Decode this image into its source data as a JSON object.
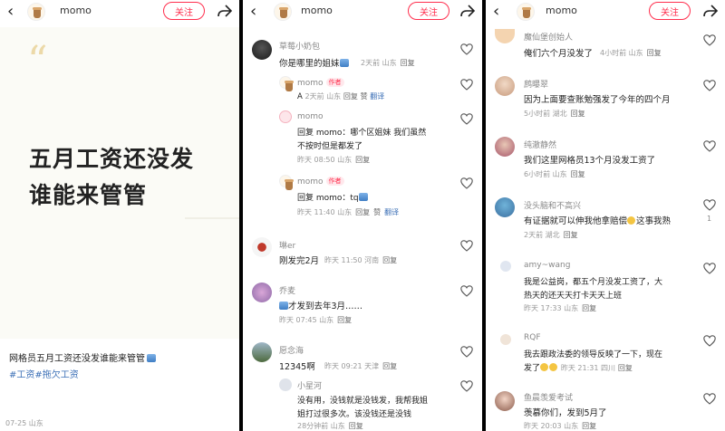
{
  "colors": {
    "accent": "#ff2e4d",
    "link": "#3b6fb6",
    "meta": "#999999"
  },
  "post_panel": {
    "username": "momo",
    "follow_label": "关注",
    "headline_line1_a": "五月",
    "headline_line1_hl": "工资",
    "headline_line1_b": "还没发",
    "headline_line2": "谁能来管管",
    "caption": "网格员五月工资还没发谁能来管管",
    "tags": "#工资#拖欠工资",
    "date": "07-25 山东"
  },
  "comments_panel_1": {
    "username": "momo",
    "follow_label": "关注",
    "comments": [
      {
        "name": "草莓小奶包",
        "text": "你是哪里的姐妹",
        "time": "2天前 山东",
        "reply": "回复"
      },
      {
        "name": "momo",
        "author_tag": "作者",
        "text": "A",
        "time": "2天前 山东",
        "reply": "回复",
        "like": "赞",
        "translate": "翻译"
      },
      {
        "name": "momo",
        "text1": "回复  momo：哪个区姐妹 我们虽然",
        "text2": "不按时但是都发了",
        "time": "昨天 08:50 山东",
        "reply": "回复"
      },
      {
        "name": "momo",
        "author_tag": "作者",
        "text": "回复  momo：tq",
        "time": "昨天 11:40 山东",
        "reply": "回复",
        "like": "赞",
        "translate": "翻译"
      },
      {
        "name": "琳er",
        "text": "刚发完2月",
        "time": "昨天 11:50 河南",
        "reply": "回复"
      },
      {
        "name": "乔麦",
        "text": "才发到去年3月……",
        "time": "昨天 07:45 山东",
        "reply": "回复"
      },
      {
        "name": "愿念海",
        "text": "12345啊",
        "time": "昨天 09:21 天津",
        "reply": "回复"
      },
      {
        "name": "小星河",
        "text1": "没有用，没钱就是没钱发，我帮我姐",
        "text2": "姐打过很多次。该没钱还是没钱",
        "time": "28分钟前 山东",
        "reply": "回复"
      }
    ]
  },
  "comments_panel_2": {
    "username": "momo",
    "follow_label": "关注",
    "comments": [
      {
        "name": "魔仙堡创始人",
        "text": "俺们六个月没发了",
        "time": "4小时前 山东",
        "reply": "回复"
      },
      {
        "name": "鹧曝翠",
        "text": "因为上面要查账勉强发了今年的四个月",
        "time": "5小时前 湖北",
        "reply": "回复"
      },
      {
        "name": "纯澈静然",
        "text": "我们这里网格员13个月没发工资了",
        "time": "6小时前 山东",
        "reply": "回复"
      },
      {
        "name": "没头脑和不高兴",
        "text_a": "有证据就可以伸我他拿赔偿",
        "text_b": "这事我熟",
        "time": "2天前 湖北",
        "reply": "回复",
        "count": "1"
      },
      {
        "name": "amy~wang",
        "text1": "我是公益岗，都五个月没发工资了，大",
        "text2": "热天的还天天打卡天天上班",
        "time": "昨天 17:33 山东",
        "reply": "回复"
      },
      {
        "name": "RQF",
        "text1": "我去跟政法委的领导反映了一下，现在",
        "text2": "发了",
        "time": "昨天 21:31 四川",
        "reply": "回复"
      },
      {
        "name": "鱼晨羡爱考试",
        "text": "羡慕你们，发到5月了",
        "time": "昨天 20:03 山东",
        "reply": "回复"
      }
    ]
  }
}
